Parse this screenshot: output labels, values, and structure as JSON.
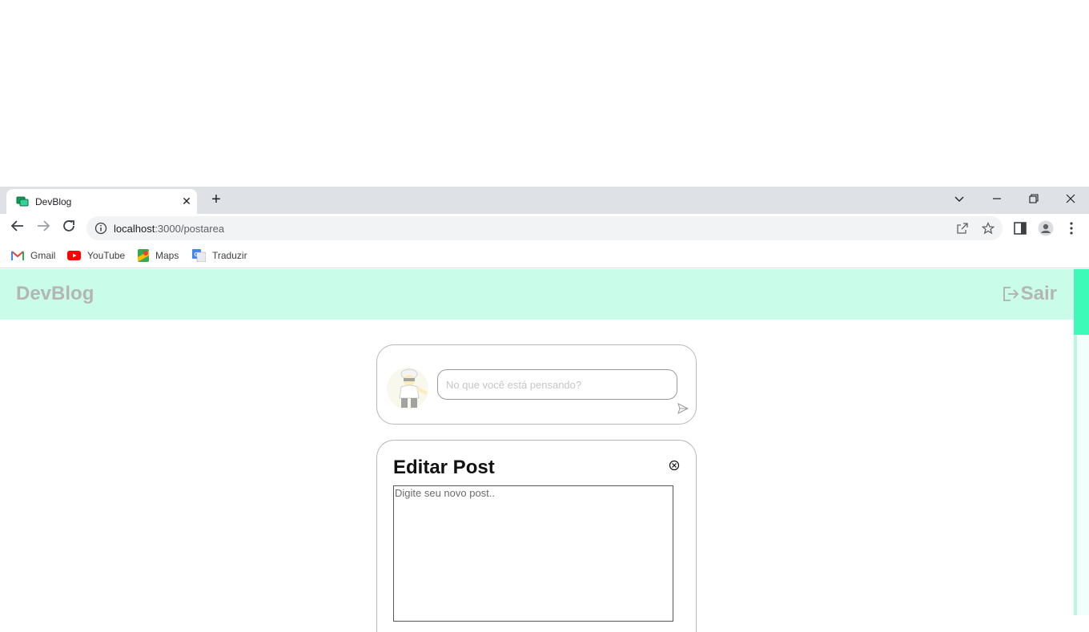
{
  "browser": {
    "tab": {
      "title": "DevBlog"
    },
    "address": {
      "host": "localhost",
      "path": ":3000/postarea"
    },
    "bookmarks": [
      {
        "label": "Gmail",
        "icon": "gmail-icon"
      },
      {
        "label": "YouTube",
        "icon": "youtube-icon"
      },
      {
        "label": "Maps",
        "icon": "maps-icon"
      },
      {
        "label": "Traduzir",
        "icon": "translate-icon"
      }
    ]
  },
  "app": {
    "brand": "DevBlog",
    "logout_label": "Sair",
    "accent": "#c9fdea",
    "compose": {
      "placeholder": "No que você está pensando?"
    },
    "edit": {
      "title": "Editar Post",
      "placeholder": "Digite seu novo post.."
    }
  }
}
